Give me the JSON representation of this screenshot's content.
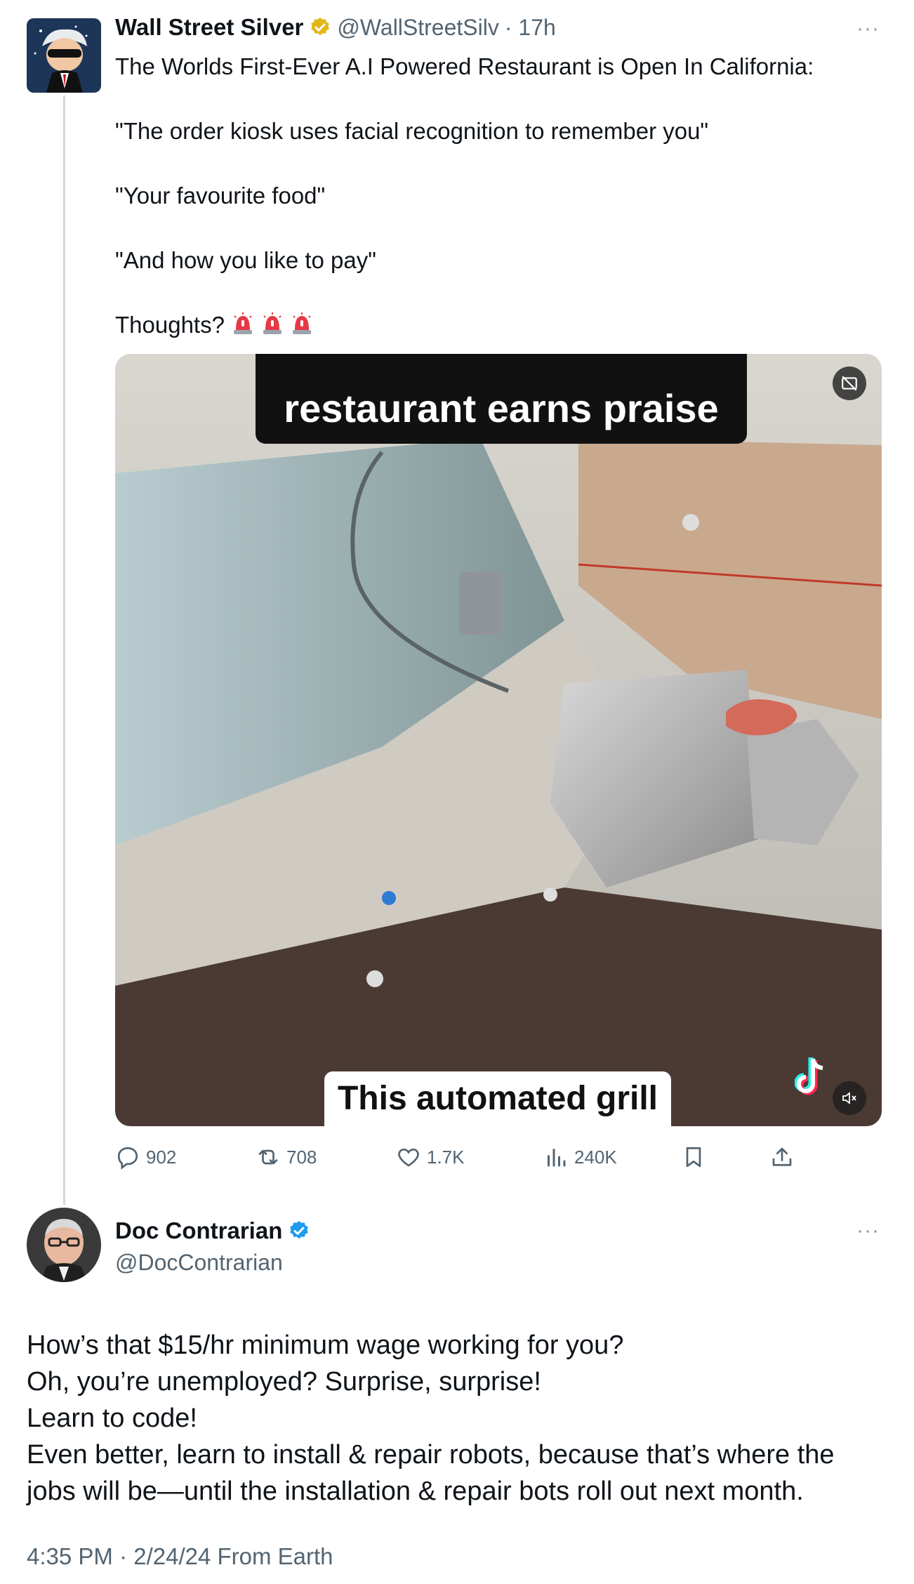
{
  "tweet": {
    "author_name": "Wall Street Silver",
    "author_handle": "@WallStreetSilv",
    "time": "· 17h",
    "more": "···",
    "lines": [
      "The Worlds First-Ever A.I Powered Restaurant is Open In California:",
      "\"The order kiosk uses facial recognition to remember you\"",
      "\"Your favourite food\"",
      "\"And how you like to pay\"",
      "Thoughts?"
    ],
    "siren_count": 3,
    "media": {
      "caption_top": "restaurant earns praise",
      "caption_bottom": "This automated grill"
    },
    "actions": {
      "replies": "902",
      "reposts": "708",
      "likes": "1.7K",
      "views": "240K"
    }
  },
  "reply": {
    "author_name": "Doc Contrarian",
    "author_handle": "@DocContrarian",
    "more": "···",
    "lines": [
      "How’s that $15/hr minimum wage working for you?",
      "Oh, you’re unemployed? Surprise, surprise!",
      "Learn to code!",
      "Even better, learn to install & repair robots, because that’s where the",
      "jobs will be—until the installation & repair bots roll out next month."
    ],
    "timestamp": "4:35 PM · 2/24/24 From Earth"
  },
  "colors": {
    "verified_gold": "#e2b719",
    "verified_blue": "#1d9bf0",
    "muted_text": "#536471",
    "thread_line": "#cfd9de"
  }
}
